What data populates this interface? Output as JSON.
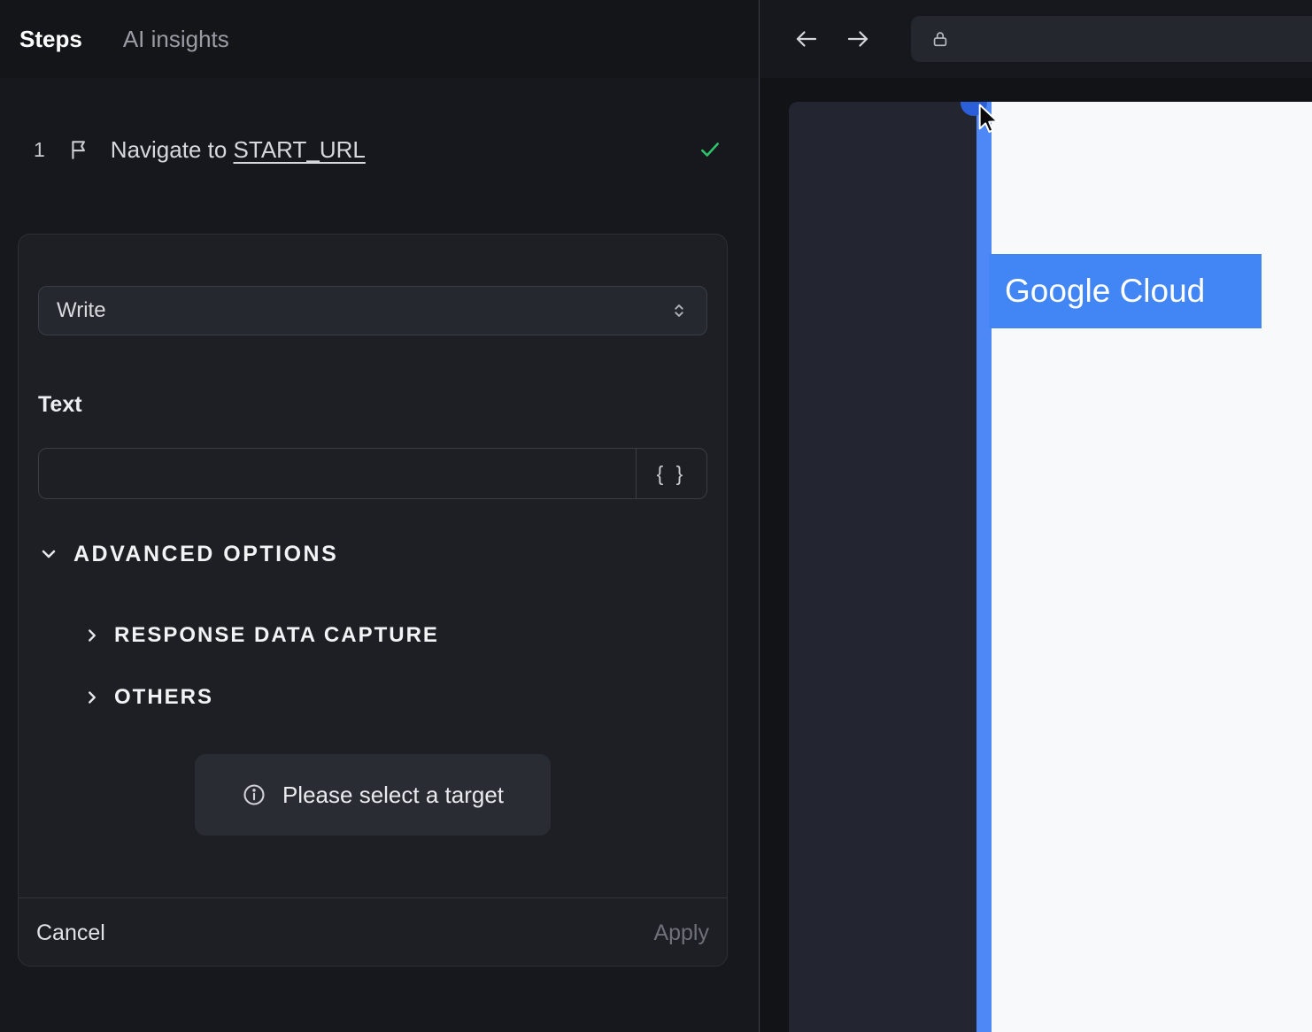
{
  "app": {
    "tabs": [
      {
        "label": "Steps",
        "active": true
      },
      {
        "label": "AI insights",
        "active": false
      }
    ]
  },
  "step": {
    "index": "1",
    "title_prefix": "Navigate to ",
    "title_target": "START_URL",
    "status": "completed"
  },
  "action_editor": {
    "action_select": {
      "value": "Write"
    },
    "text_field": {
      "label": "Text",
      "value": "",
      "placeholder": ""
    },
    "variable_button_label": "{ }",
    "advanced_options": {
      "label": "ADVANCED OPTIONS",
      "expanded": true
    },
    "subsections": [
      {
        "label": "RESPONSE DATA CAPTURE",
        "expanded": false
      },
      {
        "label": "OTHERS",
        "expanded": false
      }
    ],
    "notice": {
      "text": "Please select a target"
    },
    "footer": {
      "cancel_label": "Cancel",
      "apply_label": "Apply"
    }
  },
  "browser": {
    "url_bar": {
      "value": ""
    },
    "page": {
      "selection_label": "Google Cloud"
    }
  },
  "icons": [
    "flag-icon",
    "check-icon",
    "unfold-icon",
    "chevron-down-icon",
    "chevron-right-icon",
    "info-icon",
    "back-arrow-icon",
    "forward-arrow-icon",
    "lock-icon",
    "braces-icon",
    "cursor-pointer-icon"
  ],
  "colors": {
    "accent_blue": "#4285f4",
    "stripe_blue": "#4e87f6",
    "success_green": "#2ec269",
    "panel_bg": "#17181d",
    "card_bg": "#1d1f25",
    "page_white": "#f8f9fa",
    "page_dark": "#232531"
  }
}
